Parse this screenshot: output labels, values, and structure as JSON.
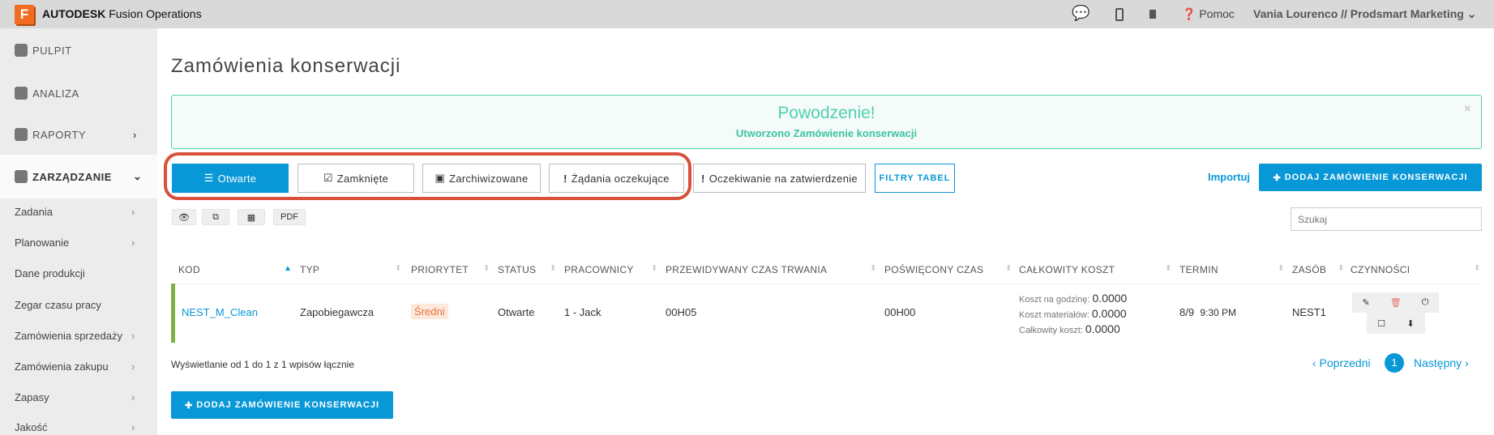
{
  "topbar": {
    "logo_letter": "F",
    "brand_bold": "AUTODESK",
    "brand_rest": "Fusion Operations",
    "help": "Pomoc",
    "user": "Vania Lourenco // Prodsmart Marketing"
  },
  "sidebar": {
    "top": [
      {
        "label": "PULPIT"
      },
      {
        "label": "ANALIZA"
      },
      {
        "label": "RAPORTY"
      },
      {
        "label": "ZARZĄDZANIE"
      }
    ],
    "sub": [
      {
        "label": "Zadania"
      },
      {
        "label": "Planowanie"
      },
      {
        "label": "Dane produkcji"
      },
      {
        "label": "Zegar czasu pracy"
      },
      {
        "label": "Zamówienia sprzedaży"
      },
      {
        "label": "Zamówienia zakupu"
      },
      {
        "label": "Zapasy"
      },
      {
        "label": "Jakość"
      }
    ]
  },
  "page": {
    "title": "Zamówienia konserwacji"
  },
  "alert": {
    "title": "Powodzenie!",
    "message": "Utworzono Zamówienie konserwacji",
    "close": "×"
  },
  "tabs": [
    {
      "label": "Otwarte"
    },
    {
      "label": "Zamknięte"
    },
    {
      "label": "Zarchiwizowane"
    },
    {
      "label": "Żądania oczekujące"
    },
    {
      "label": "Oczekiwanie na zatwierdzenie"
    }
  ],
  "toolbar": {
    "filters": "FILTRY TABEL",
    "import": "Importuj",
    "add": "DODAJ ZAMÓWIENIE KONSERWACJI",
    "pdf": "PDF",
    "search_placeholder": "Szukaj"
  },
  "table": {
    "headers": [
      "KOD",
      "TYP",
      "PRIORYTET",
      "STATUS",
      "PRACOWNICY",
      "PRZEWIDYWANY CZAS TRWANIA",
      "POŚWIĘCONY CZAS",
      "CAŁKOWITY KOSZT",
      "TERMIN",
      "ZASÓB",
      "CZYNNOŚCI"
    ],
    "rows": [
      {
        "code": "NEST_M_Clean",
        "type": "Zapobiegawcza",
        "priority": "Średni",
        "status": "Otwarte",
        "workers": "1 - Jack",
        "planned": "00H05",
        "spent": "00H00",
        "cost_hour_label": "Koszt na godzinę:",
        "cost_hour": "0.0000",
        "cost_mat_label": "Koszt materiałów:",
        "cost_mat": "0.0000",
        "cost_total_label": "Całkowity koszt:",
        "cost_total": "0.0000",
        "due_date": "8/9",
        "due_time": "9:30 PM",
        "asset": "NEST1"
      }
    ]
  },
  "footer": {
    "info": "Wyświetlanie od 1 do 1 z 1 wpisów łącznie",
    "prev": "‹ Poprzedni",
    "page": "1",
    "next": "Następny ›"
  },
  "colors": {
    "primary": "#0897d7",
    "success": "#4fd1b0",
    "highlight": "#d9503a"
  }
}
